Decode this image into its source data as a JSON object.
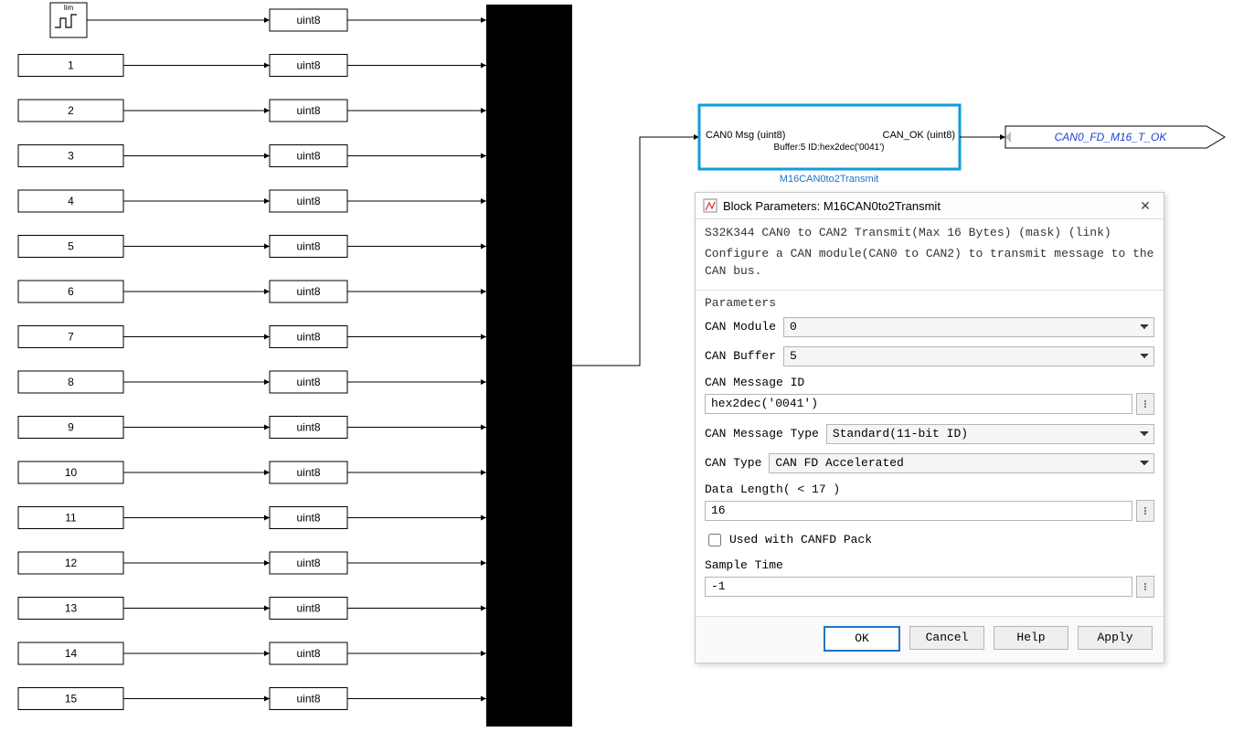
{
  "diagram": {
    "lim_label": "lim",
    "uint8_label": "uint8",
    "constants": [
      "1",
      "2",
      "3",
      "4",
      "5",
      "6",
      "7",
      "8",
      "9",
      "10",
      "11",
      "12",
      "13",
      "14",
      "15"
    ],
    "can_block": {
      "line1_left": "CAN0 Msg (uint8)",
      "line1_right": "CAN_OK (uint8)",
      "line2": "Buffer:5  ID:hex2dec('0041')",
      "caption": "M16CAN0to2Transmit"
    },
    "goto_label": "CAN0_FD_M16_T_OK"
  },
  "dialog": {
    "title": "Block Parameters: M16CAN0to2Transmit",
    "desc_line1": "S32K344 CAN0 to CAN2 Transmit(Max 16 Bytes) (mask) (link)",
    "desc_line2": "Configure a CAN module(CAN0 to CAN2) to transmit message to the CAN bus.",
    "section_title": "Parameters",
    "labels": {
      "module": "CAN Module",
      "buffer": "CAN Buffer",
      "msgid": "CAN Message ID",
      "msgtype": "CAN Message Type",
      "cantype": "CAN Type",
      "datalen": "Data Length( < 17 )",
      "canfdpack": "Used with CANFD Pack",
      "sampletime": "Sample Time"
    },
    "values": {
      "module": "0",
      "buffer": "5",
      "msgid": "hex2dec('0041')",
      "msgtype": "Standard(11-bit ID)",
      "cantype": "CAN FD Accelerated",
      "datalen": "16",
      "canfdpack_checked": false,
      "sampletime": "-1"
    },
    "buttons": {
      "ok": "OK",
      "cancel": "Cancel",
      "help": "Help",
      "apply": "Apply"
    }
  }
}
